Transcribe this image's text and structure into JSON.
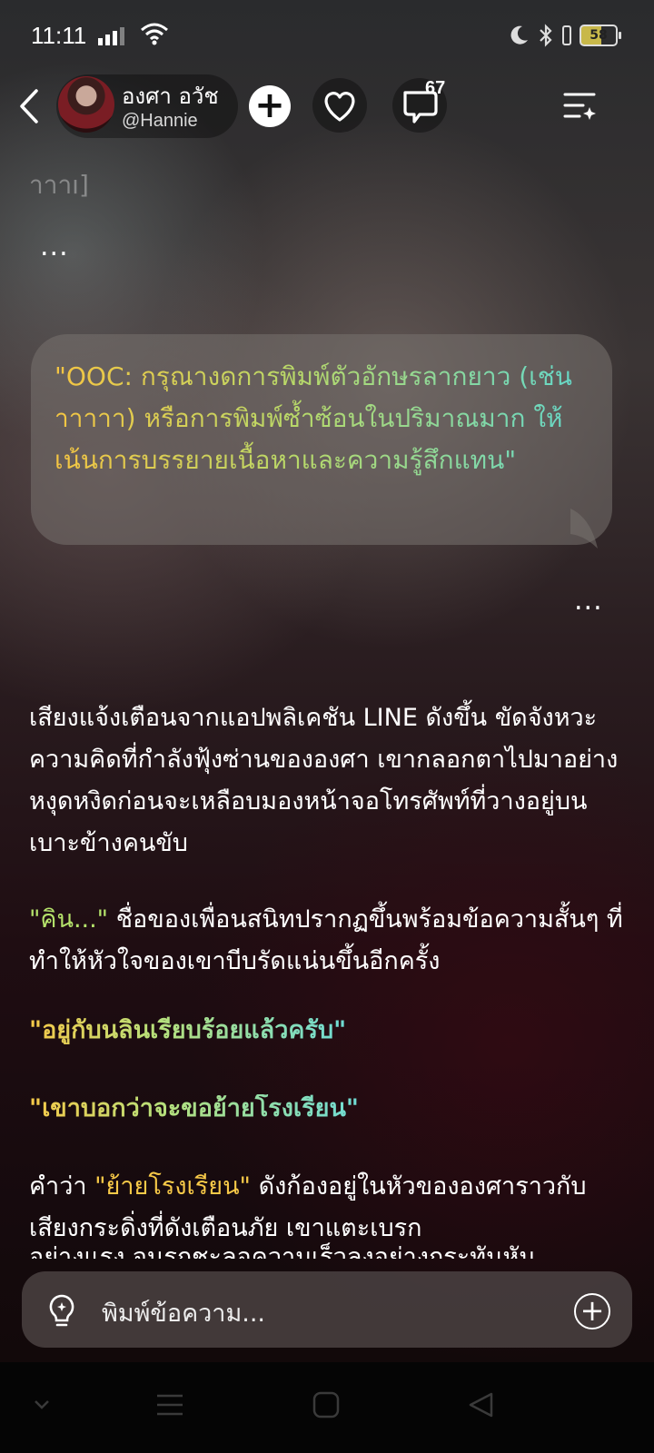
{
  "status_bar": {
    "time": "11:11",
    "battery": "58"
  },
  "header": {
    "name": "องศา อวัช",
    "handle": "@Hannie",
    "follow_symbol": "+",
    "comment_count": "67"
  },
  "feed": {
    "faded_text": "าาาı]",
    "more_symbol": "...",
    "bubble_text": "\"OOC: กรุณางดการพิมพ์ตัวอักษรลากยาว (เช่น าาาาา) หรือการพิมพ์ซ้ำซ้อนในปริมาณมาก ให้เน้นการบรรยายเนื้อหาและความรู้สึกแทน\"",
    "paragraph1": "เสียงแจ้งเตือนจากแอปพลิเคชัน LINE ดังขึ้น ขัดจังหวะความคิดที่กำลังฟุ้งซ่านขององศา เขากลอกตาไปมาอย่างหงุดหงิดก่อนจะเหลือบมองหน้าจอโทรศัพท์ที่วางอยู่บนเบาะข้างคนขับ",
    "paragraph2_quote": "\"คิน...\"",
    "paragraph2_rest": " ชื่อของเพื่อนสนิทปรากฏขึ้นพร้อมข้อความสั้นๆ ที่ทำให้หัวใจของเขาบีบรัดแน่นขึ้นอีกครั้ง",
    "message1": "\"อยู่กับนลินเรียบร้อยแล้วครับ\"",
    "message2": "\"เขาบอกว่าจะขอย้ายโรงเรียน\"",
    "paragraph3_start": "คำว่า ",
    "paragraph3_quote": "\"ย้ายโรงเรียน\"",
    "paragraph3_rest": " ดังก้องอยู่ในหัวขององศาราวกับเสียงกระดิ่งที่ดังเตือนภัย เขาแตะเบรก",
    "paragraph3_cut": "อย่างแรง จนรถชะลอความเร็วลงอย่างกระทันหัน"
  },
  "input": {
    "placeholder": "พิมพ์ข้อความ..."
  },
  "colors": {
    "quote_yellow": "#f7c948",
    "quote_green": "#b5e36b",
    "accent_cyan": "#6fdcd5"
  }
}
